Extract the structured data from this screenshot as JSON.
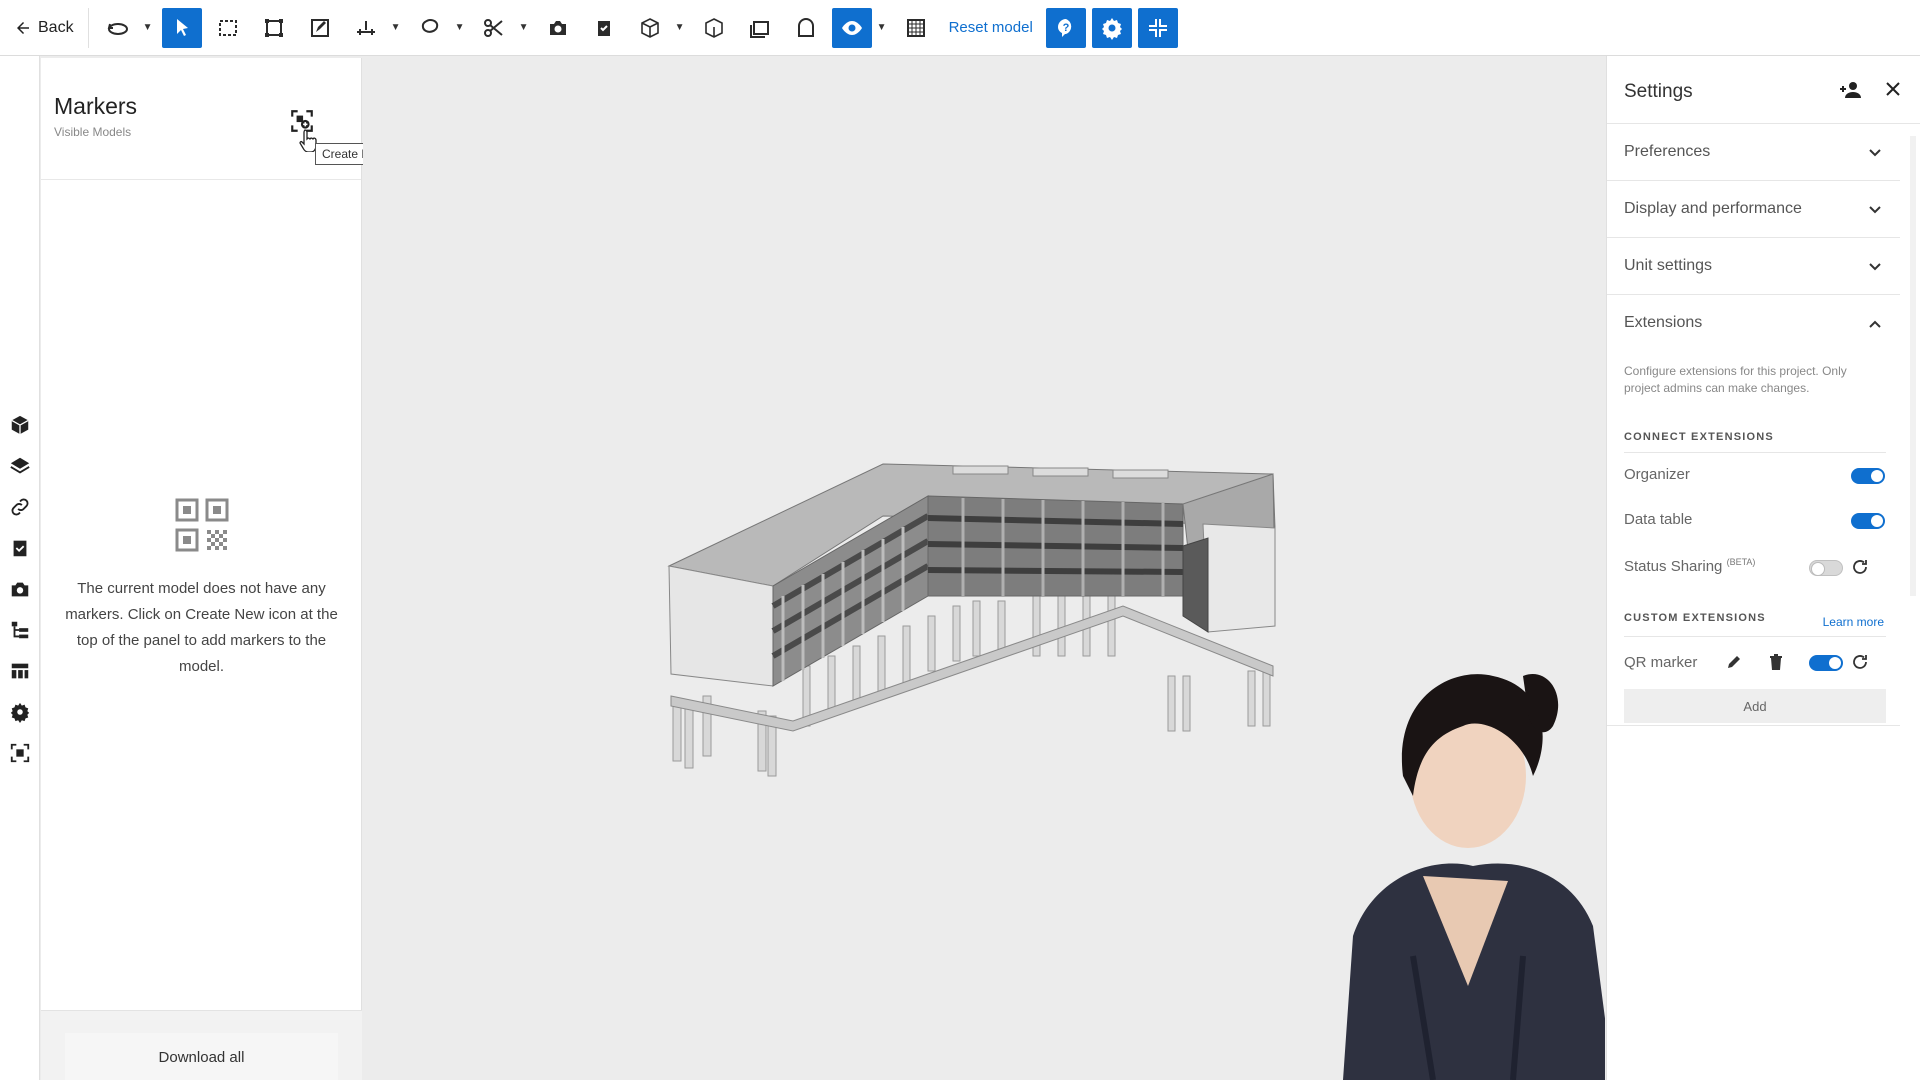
{
  "toolbar": {
    "back_label": "Back",
    "reset_label": "Reset model"
  },
  "markers": {
    "title": "Markers",
    "subtitle": "Visible Models",
    "tooltip": "Create New",
    "empty_message": "The current model does not have any markers. Click on Create New icon at the top of the panel to add markers to the model.",
    "download_label": "Download all"
  },
  "settings": {
    "title": "Settings",
    "sections": [
      {
        "label": "Preferences",
        "expanded": false
      },
      {
        "label": "Display and performance",
        "expanded": false
      },
      {
        "label": "Unit settings",
        "expanded": false
      }
    ],
    "extensions": {
      "label": "Extensions",
      "expanded": true,
      "description": "Configure extensions for this project. Only project admins can make changes.",
      "connect_heading": "CONNECT EXTENSIONS",
      "custom_heading": "CUSTOM EXTENSIONS",
      "learn_more": "Learn more",
      "items": [
        {
          "label": "Organizer",
          "enabled": true
        },
        {
          "label": "Data table",
          "enabled": true
        },
        {
          "label": "Status Sharing",
          "badge": "(BETA)",
          "enabled": false
        }
      ],
      "custom_items": [
        {
          "label": "QR marker",
          "enabled": true
        }
      ],
      "add_label": "Add"
    }
  },
  "colors": {
    "accent": "#0f6fcf",
    "background": "#ececec"
  }
}
